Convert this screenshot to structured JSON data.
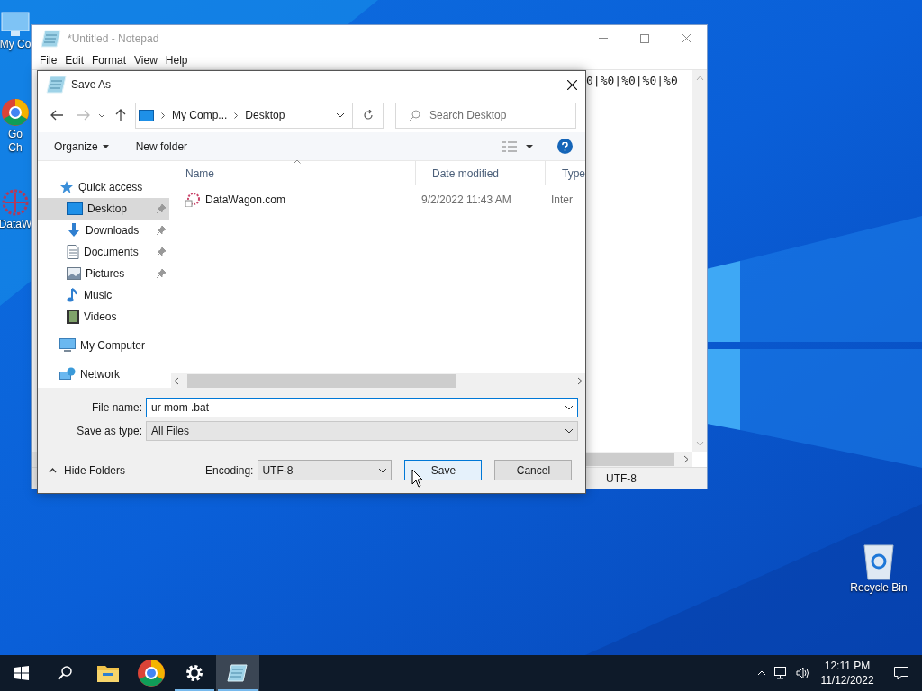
{
  "desktop_icons": [
    {
      "kind": "computer",
      "lines": [
        "My Co"
      ]
    },
    {
      "kind": "chrome",
      "lines": [
        "Go",
        "Ch"
      ]
    },
    {
      "kind": "datawagon",
      "lines": [
        "DataW"
      ]
    },
    {
      "kind": "recycle",
      "lines": [
        "Recycle Bin"
      ]
    }
  ],
  "notepad": {
    "title": "*Untitled - Notepad",
    "menu": [
      "File",
      "Edit",
      "Format",
      "View",
      "Help"
    ],
    "text": "0|%0|%0|%0|%0",
    "status_encoding": "UTF-8"
  },
  "dialog": {
    "title": "Save As",
    "breadcrumb": [
      "My Comp...",
      "Desktop"
    ],
    "search_placeholder": "Search Desktop",
    "organize": "Organize",
    "new_folder": "New folder",
    "nav": [
      {
        "kind": "star",
        "label": "Quick access",
        "selected": false,
        "children": [
          {
            "kind": "desktop",
            "label": "Desktop",
            "selected": true,
            "pinned": true
          },
          {
            "kind": "downloads",
            "label": "Downloads",
            "selected": false,
            "pinned": true
          },
          {
            "kind": "documents",
            "label": "Documents",
            "selected": false,
            "pinned": true
          },
          {
            "kind": "pictures",
            "label": "Pictures",
            "selected": false,
            "pinned": true
          },
          {
            "kind": "music",
            "label": "Music",
            "selected": false,
            "pinned": false
          },
          {
            "kind": "videos",
            "label": "Videos",
            "selected": false,
            "pinned": false
          }
        ]
      },
      {
        "kind": "computer",
        "label": "My Computer",
        "selected": false
      },
      {
        "kind": "network",
        "label": "Network",
        "selected": false
      }
    ],
    "columns": [
      "Name",
      "Date modified",
      "Type"
    ],
    "files": [
      {
        "name": "DataWagon.com",
        "date": "9/2/2022 11:43 AM",
        "type": "Inter"
      }
    ],
    "file_name_label": "File name:",
    "file_name": "ur mom .bat",
    "save_as_type_label": "Save as type:",
    "save_as_type": "All Files",
    "hide_folders": "Hide Folders",
    "encoding_label": "Encoding:",
    "encoding": "UTF-8",
    "buttons": [
      {
        "label": "Save",
        "default": true
      },
      {
        "label": "Cancel",
        "default": false
      }
    ]
  },
  "taskbar": {
    "apps": [
      {
        "kind": "start",
        "running": false,
        "selected": false
      },
      {
        "kind": "search",
        "running": false,
        "selected": false
      },
      {
        "kind": "explorer",
        "running": false,
        "selected": false
      },
      {
        "kind": "chrome",
        "running": false,
        "selected": false
      },
      {
        "kind": "settings",
        "running": true,
        "selected": false
      },
      {
        "kind": "notepad",
        "running": true,
        "selected": true
      }
    ],
    "time": "12:11 PM",
    "date": "11/12/2022"
  }
}
